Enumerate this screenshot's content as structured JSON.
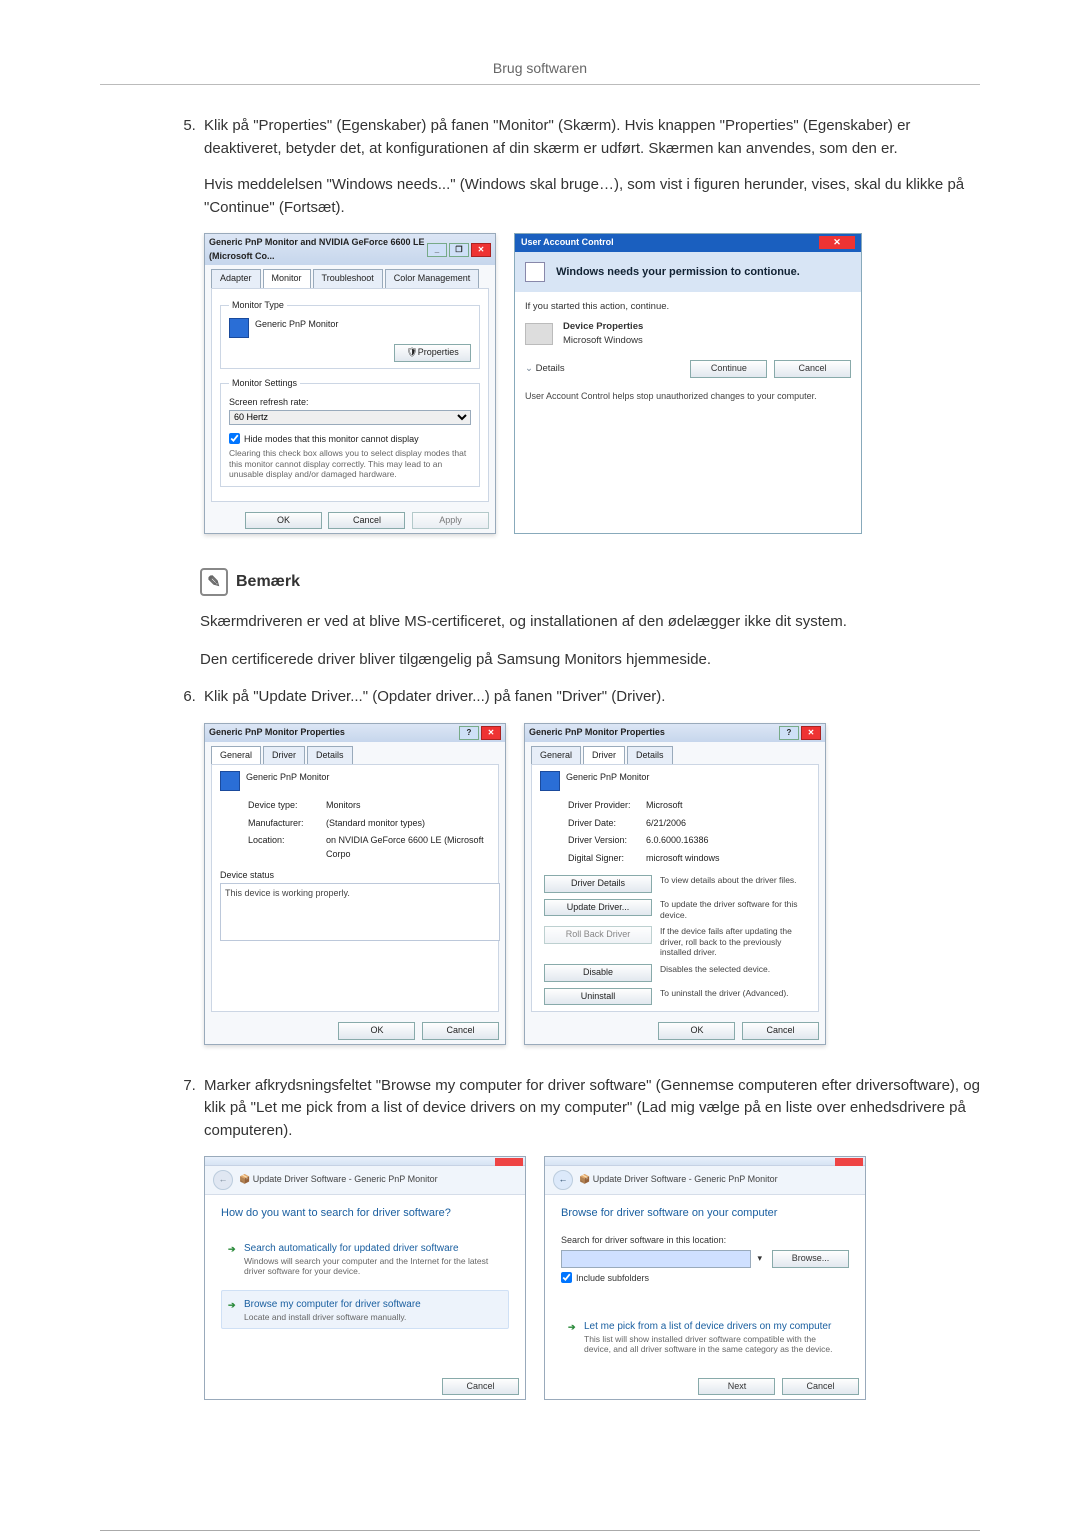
{
  "header": "Brug softwaren",
  "step5": {
    "num": "5.",
    "p1": "Klik på \"Properties\" (Egenskaber) på fanen \"Monitor\" (Skærm). Hvis knappen \"Properties\" (Egenskaber) er deaktiveret, betyder det, at konfigurationen af din skærm er udført. Skærmen kan anvendes, som den er.",
    "p2": "Hvis meddelelsen \"Windows needs...\" (Windows skal bruge…), som vist i figuren herunder, vises, skal du klikke på \"Continue\" (Fortsæt)."
  },
  "fig5a": {
    "title": "Generic PnP Monitor and NVIDIA GeForce 6600 LE (Microsoft Co...",
    "tabs": [
      "Adapter",
      "Monitor",
      "Troubleshoot",
      "Color Management"
    ],
    "grp1": "Monitor Type",
    "monname": "Generic PnP Monitor",
    "props_btn": "Properties",
    "grp2": "Monitor Settings",
    "refresh_lbl": "Screen refresh rate:",
    "refresh_val": "60 Hertz",
    "hide_chk": "Hide modes that this monitor cannot display",
    "hide_desc": "Clearing this check box allows you to select display modes that this monitor cannot display correctly. This may lead to an unusable display and/or damaged hardware.",
    "ok": "OK",
    "cancel": "Cancel",
    "apply": "Apply"
  },
  "fig5b": {
    "title": "User Account Control",
    "heading": "Windows needs your permission to contionue.",
    "if_started": "If you started this action, continue.",
    "devprops": "Device Properties",
    "mswin": "Microsoft Windows",
    "details": "Details",
    "continue": "Continue",
    "cancel": "Cancel",
    "footer": "User Account Control helps stop unauthorized changes to your computer."
  },
  "note": {
    "title": "Bemærk",
    "p1": "Skærmdriveren er ved at blive MS-certificeret, og installationen af den ødelægger ikke dit system.",
    "p2": "Den certificerede driver bliver tilgængelig på Samsung Monitors hjemmeside."
  },
  "step6": {
    "num": "6.",
    "p1": "Klik på \"Update Driver...\" (Opdater driver...) på fanen \"Driver\" (Driver)."
  },
  "fig6a": {
    "title": "Generic PnP Monitor Properties",
    "tabs": [
      "General",
      "Driver",
      "Details"
    ],
    "monname": "Generic PnP Monitor",
    "dtype_l": "Device type:",
    "dtype_v": "Monitors",
    "mfr_l": "Manufacturer:",
    "mfr_v": "(Standard monitor types)",
    "loc_l": "Location:",
    "loc_v": "on NVIDIA GeForce 6600 LE (Microsoft Corpo",
    "devstat_l": "Device status",
    "devstat_v": "This device is working properly.",
    "ok": "OK",
    "cancel": "Cancel"
  },
  "fig6b": {
    "title": "Generic PnP Monitor Properties",
    "tabs": [
      "General",
      "Driver",
      "Details"
    ],
    "monname": "Generic PnP Monitor",
    "prov_l": "Driver Provider:",
    "prov_v": "Microsoft",
    "date_l": "Driver Date:",
    "date_v": "6/21/2006",
    "ver_l": "Driver Version:",
    "ver_v": "6.0.6000.16386",
    "sign_l": "Digital Signer:",
    "sign_v": "microsoft windows",
    "b_details": "Driver Details",
    "d_details": "To view details about the driver files.",
    "b_update": "Update Driver...",
    "d_update": "To update the driver software for this device.",
    "b_roll": "Roll Back Driver",
    "d_roll": "If the device fails after updating the driver, roll back to the previously installed driver.",
    "b_dis": "Disable",
    "d_dis": "Disables the selected device.",
    "b_un": "Uninstall",
    "d_un": "To uninstall the driver (Advanced).",
    "ok": "OK",
    "cancel": "Cancel"
  },
  "step7": {
    "num": "7.",
    "p1": "Marker afkrydsningsfeltet \"Browse my computer for driver software\" (Gennemse computeren efter driversoftware), og klik på \"Let me pick from a list of device drivers on my computer\" (Lad mig vælge på en liste over enhedsdrivere på computeren)."
  },
  "fig7a": {
    "crumb": "Update Driver Software - Generic PnP Monitor",
    "heading": "How do you want to search for driver software?",
    "opt1_t": "Search automatically for updated driver software",
    "opt1_s": "Windows will search your computer and the Internet for the latest driver software for your device.",
    "opt2_t": "Browse my computer for driver software",
    "opt2_s": "Locate and install driver software manually.",
    "cancel": "Cancel"
  },
  "fig7b": {
    "crumb": "Update Driver Software - Generic PnP Monitor",
    "heading": "Browse for driver software on your computer",
    "searchloc": "Search for driver software in this location:",
    "browse": "Browse...",
    "incsub": "Include subfolders",
    "opt_t": "Let me pick from a list of device drivers on my computer",
    "opt_s": "This list will show installed driver software compatible with the device, and all driver software in the same category as the device.",
    "next": "Next",
    "cancel": "Cancel"
  }
}
